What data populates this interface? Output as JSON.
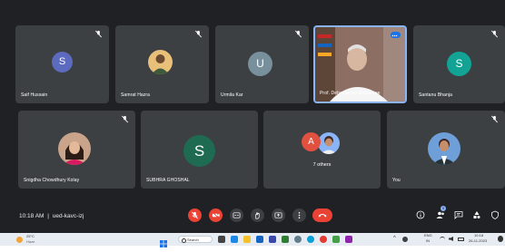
{
  "participants": [
    {
      "name": "Saif Hussain",
      "initial": "S",
      "color": "#5c6bc0"
    },
    {
      "name": "Samrat Hazra",
      "initial": "",
      "color": "#e8c07a"
    },
    {
      "name": "Urmila Kar",
      "initial": "U",
      "color": "#78909c"
    },
    {
      "name": "Prof. Debaprasad Mukherjee",
      "initial": "",
      "color": "#8d6e63"
    },
    {
      "name": "Santanu Bhanja",
      "initial": "S",
      "color": "#12a395"
    },
    {
      "name": "Snigdha Chowdhury Kolay",
      "initial": "",
      "color": "#c9a48a"
    },
    {
      "name": "SUBHRA GHOSHAL",
      "initial": "S",
      "color": "#1e6b52"
    },
    {
      "name": "7 others",
      "initial": "A",
      "color": "#e0523f"
    },
    {
      "name": "You",
      "initial": "",
      "color": "#6f9fd8"
    }
  ],
  "others_label": "7 others",
  "meeting": {
    "time": "10:18 AM",
    "separator": "|",
    "code": "ued-kavc-izj"
  },
  "chat_badge": "9",
  "taskbar": {
    "weather_temp": "25°C",
    "weather_desc": "Haze",
    "search_label": "Search",
    "lang_top": "ENG",
    "lang_bottom": "IN",
    "clock_time": "10:18",
    "clock_date": "26-11-2023"
  },
  "colors": {
    "meet_bg": "#202124",
    "tile_bg": "#3c4043",
    "accent": "#8ab4f8",
    "danger": "#ea4335"
  }
}
